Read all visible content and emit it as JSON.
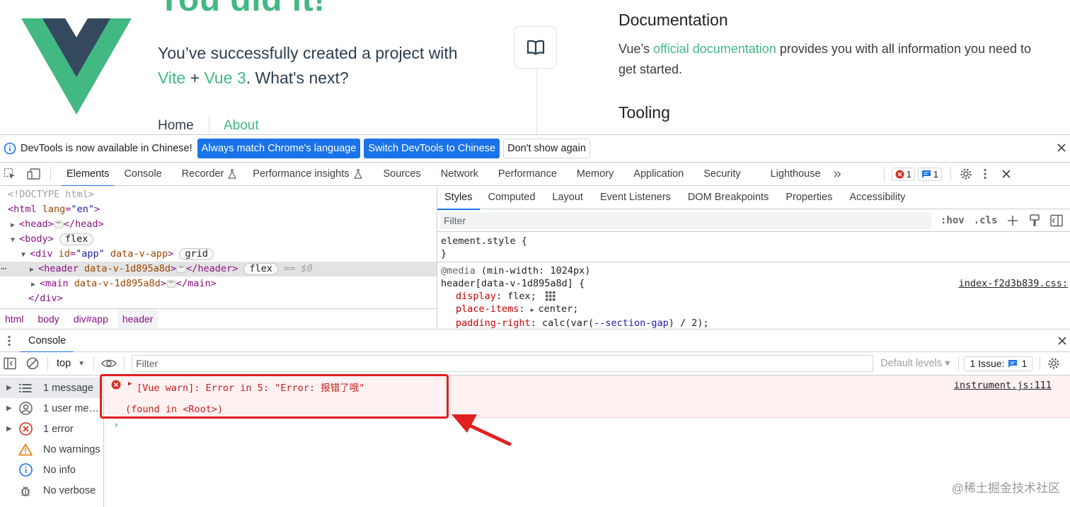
{
  "page": {
    "hero_title": "You did it!",
    "hero_text_1": "You’ve successfully created a project with",
    "vite": "Vite",
    "plus": " + ",
    "vue3": "Vue 3",
    "hero_text_2": ". What's next?",
    "nav_home": "Home",
    "nav_about": "About",
    "doc_title": "Documentation",
    "doc_text_1": "Vue’s ",
    "doc_link": "official documentation",
    "doc_text_2": " provides you with all information you need to get started.",
    "tooling_title": "Tooling",
    "colors": {
      "vue_green": "#42b883",
      "vue_dark": "#35495e"
    }
  },
  "infobar": {
    "message": "DevTools is now available in Chinese!",
    "btn_match": "Always match Chrome's language",
    "btn_switch": "Switch DevTools to Chinese",
    "btn_dismiss": "Don't show again"
  },
  "main_tabs": {
    "tabs": [
      "Elements",
      "Console",
      "Recorder",
      "Performance insights",
      "Sources",
      "Network",
      "Performance",
      "Memory",
      "Application",
      "Security",
      "Lighthouse"
    ],
    "more": "»",
    "error_count": "1",
    "message_count": "1"
  },
  "elements": {
    "doctype": "<!DOCTYPE html>",
    "html_open": "<html",
    "lang_attr": "lang",
    "lang_val": "\"en\"",
    "close_bracket": ">",
    "head_open": "<head>",
    "head_close": "</head>",
    "body_open": "<body>",
    "flex_pill": "flex",
    "div_open": "<div",
    "id_attr": "id",
    "id_val": "\"app\"",
    "data_v_app": "data-v-app",
    "grid_pill": "grid",
    "header_open": "<header",
    "header_attr": "data-v-1d895a8d",
    "header_close": "</header>",
    "selected_marker": "== $0",
    "main_open": "<main",
    "main_close": "</main>",
    "div_close": "</div>",
    "ellipsis": "⋯",
    "gutter_dots": "⋯"
  },
  "breadcrumb": [
    "html",
    "body",
    "div#app",
    "header"
  ],
  "styles": {
    "tabs": [
      "Styles",
      "Computed",
      "Layout",
      "Event Listeners",
      "DOM Breakpoints",
      "Properties",
      "Accessibility"
    ],
    "filter_placeholder": "Filter",
    "hov": ":hov",
    "cls": ".cls",
    "element_style": "element.style {",
    "close_brace": "}",
    "media_kw": "@media",
    "media_query": " (min-width: 1024px)",
    "rule_selector": "header[data-v-1d895a8d] {",
    "rule_source": "index-f2d3b839.css:",
    "props": [
      {
        "name": "display",
        "value": "flex;"
      },
      {
        "name": "place-items",
        "value": "center;"
      },
      {
        "name": "padding-right",
        "value_pre": "calc(var(",
        "value_var": "--section-gap",
        "value_post": ") / 2);"
      }
    ],
    "colon": ": "
  },
  "drawer": {
    "tab": "Console",
    "context": "top",
    "filter_placeholder": "Filter",
    "levels": "Default levels ▾",
    "issues_label": "1 Issue:",
    "issues_count": "1"
  },
  "console_sidebar": [
    {
      "label": "1 message",
      "icon": "list-icon"
    },
    {
      "label": "1 user me…",
      "icon": "user-icon"
    },
    {
      "label": "1 error",
      "icon": "error-icon"
    },
    {
      "label": "No warnings",
      "icon": "warning-icon"
    },
    {
      "label": "No info",
      "icon": "info-icon"
    },
    {
      "label": "No verbose",
      "icon": "bug-icon"
    }
  ],
  "console_message": {
    "line1": "[Vue warn]: Error in 5: \"Error: 报错了哦\"",
    "line2": "(found in <Root>)",
    "source": "instrument.js:111",
    "prompt": "›"
  },
  "annotation": {
    "highlight_color": "#e02020"
  },
  "watermark": "@稀土掘金技术社区"
}
